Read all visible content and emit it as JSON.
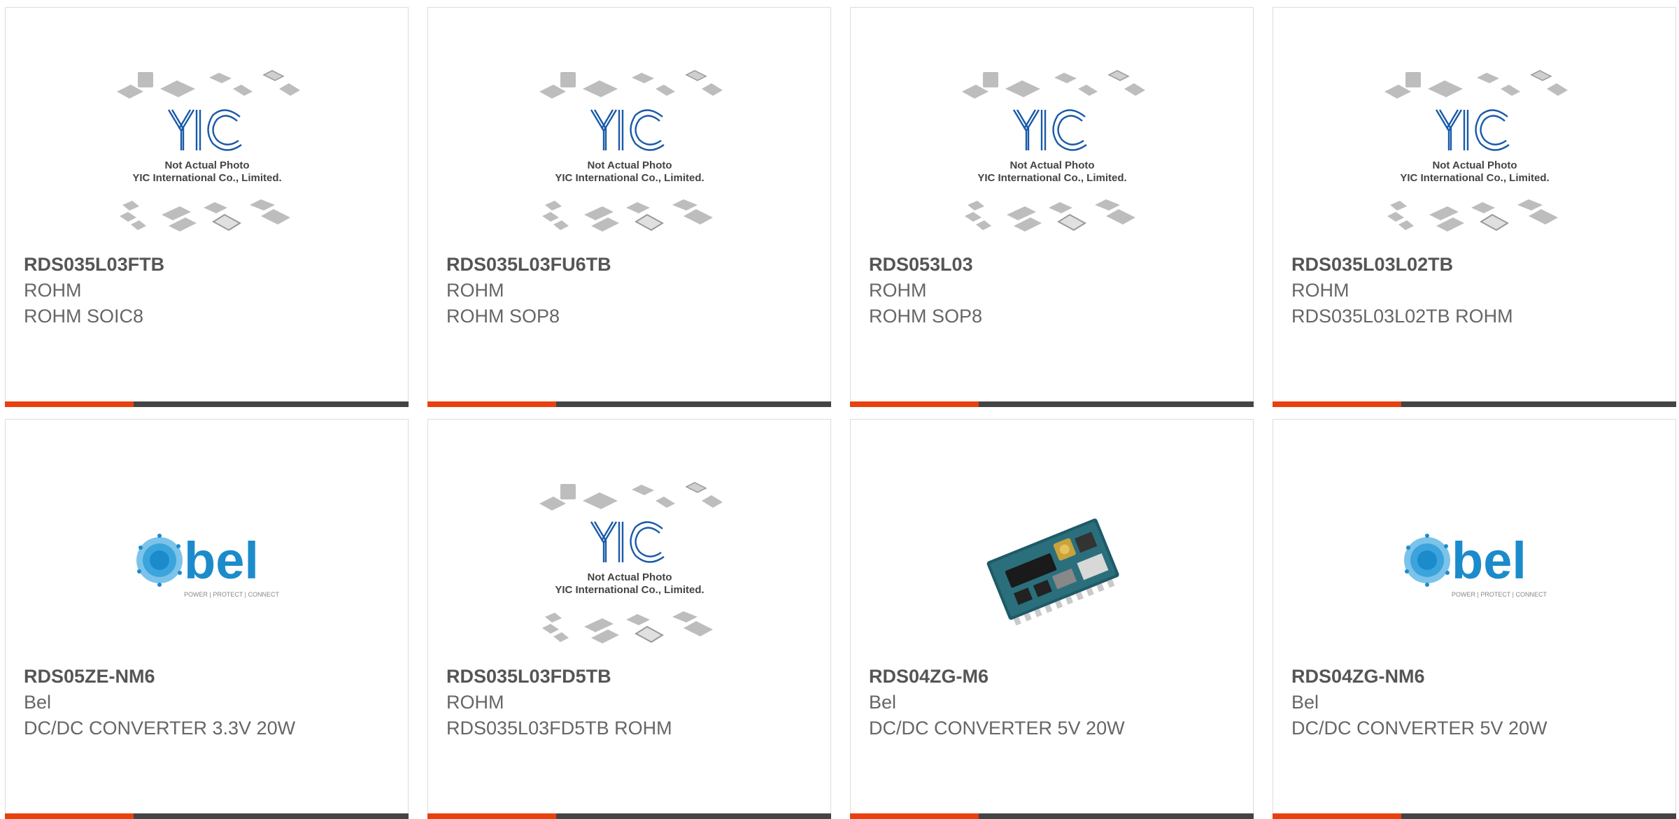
{
  "colors": {
    "accent": "#e8400f",
    "bar_dark": "#444444",
    "yic_blue": "#1a5aa8",
    "bel_blue": "#1c8bcb"
  },
  "placeholder": {
    "line1": "Not Actual Photo",
    "line2": "YIC International Co., Limited.",
    "logo_text": "YIC"
  },
  "bel_logo": {
    "wordmark": "bel",
    "tagline": "POWER | PROTECT | CONNECT"
  },
  "products": [
    {
      "part": "RDS035L03FTB",
      "brand": "ROHM",
      "desc": "ROHM SOIC8",
      "image": "yic-placeholder"
    },
    {
      "part": "RDS035L03FU6TB",
      "brand": "ROHM",
      "desc": "ROHM SOP8",
      "image": "yic-placeholder"
    },
    {
      "part": "RDS053L03",
      "brand": "ROHM",
      "desc": "ROHM SOP8",
      "image": "yic-placeholder"
    },
    {
      "part": "RDS035L03L02TB",
      "brand": "ROHM",
      "desc": "RDS035L03L02TB ROHM",
      "image": "yic-placeholder"
    },
    {
      "part": "RDS05ZE-NM6",
      "brand": "Bel",
      "desc": "DC/DC CONVERTER 3.3V 20W",
      "image": "bel-logo"
    },
    {
      "part": "RDS035L03FD5TB",
      "brand": "ROHM",
      "desc": "RDS035L03FD5TB ROHM",
      "image": "yic-placeholder"
    },
    {
      "part": "RDS04ZG-M6",
      "brand": "Bel",
      "desc": "DC/DC CONVERTER 5V 20W",
      "image": "pcb-module-photo"
    },
    {
      "part": "RDS04ZG-NM6",
      "brand": "Bel",
      "desc": "DC/DC CONVERTER 5V 20W",
      "image": "bel-logo"
    }
  ]
}
